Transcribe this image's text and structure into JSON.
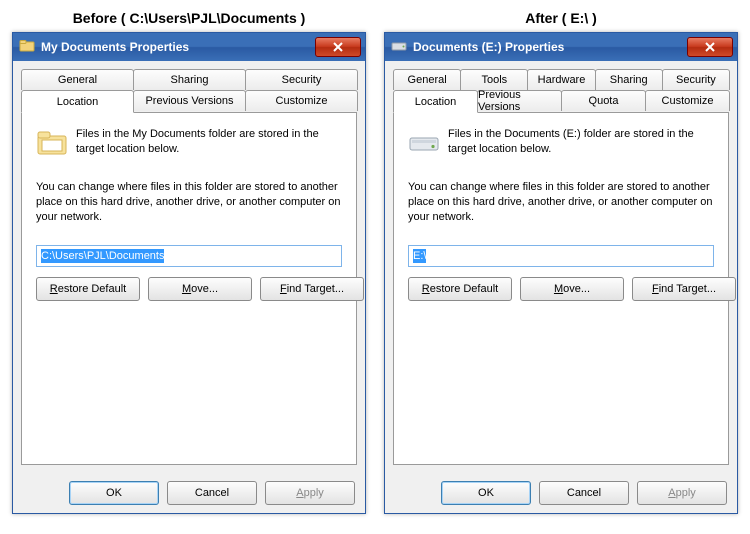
{
  "left": {
    "caption": "Before ( C:\\Users\\PJL\\Documents )",
    "title": "My Documents Properties",
    "tabsRow1": [
      "General",
      "Sharing",
      "Security"
    ],
    "tabsRow2": [
      "Location",
      "Previous Versions",
      "Customize"
    ],
    "activeTab": "Location",
    "storedText": "Files in the My Documents folder are stored in the target location below.",
    "changeText": "You can change where files in this folder are stored to another place on this hard drive, another drive, or another computer on your network.",
    "path": "C:\\Users\\PJL\\Documents",
    "restore_label": "Restore Default",
    "restore_mnemonic": "R",
    "move_label": "Move...",
    "move_mnemonic": "M",
    "find_label": "Find Target...",
    "find_mnemonic": "F",
    "ok": "OK",
    "cancel": "Cancel",
    "apply": "Apply",
    "apply_mnemonic": "A"
  },
  "right": {
    "caption": "After ( E:\\ )",
    "title": "Documents (E:) Properties",
    "tabsRow1": [
      "General",
      "Tools",
      "Hardware",
      "Sharing",
      "Security"
    ],
    "tabsRow2": [
      "Location",
      "Previous Versions",
      "Quota",
      "Customize"
    ],
    "activeTab": "Location",
    "storedText": "Files in the Documents (E:) folder are stored in the target location below.",
    "changeText": "You can change where files in this folder are stored to another place on this hard drive, another drive, or another computer on your network.",
    "path": "E:\\",
    "restore_label": "Restore Default",
    "restore_mnemonic": "R",
    "move_label": "Move...",
    "move_mnemonic": "M",
    "find_label": "Find Target...",
    "find_mnemonic": "F",
    "ok": "OK",
    "cancel": "Cancel",
    "apply": "Apply",
    "apply_mnemonic": "A"
  }
}
